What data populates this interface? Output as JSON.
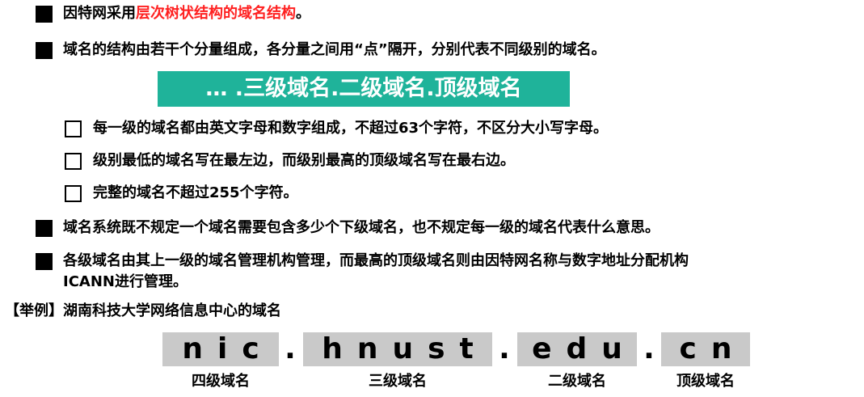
{
  "bullets": [
    {
      "prefix": "因特网采用",
      "highlight": "层次树状结构的域名结构",
      "suffix": "。"
    },
    {
      "text": "域名的结构由若干个分量组成，各分量之间用“点”隔开，分别代表不同级别的域名。"
    }
  ],
  "banner": "… .三级域名.二级域名.顶级域名",
  "sub_items": [
    "每一级的域名都由英文字母和数字组成，不超过63个字符，不区分大小写字母。",
    "级别最低的域名写在最左边，而级别最高的顶级域名写在最右边。",
    "完整的域名不超过255个字符。"
  ],
  "bullets2": [
    "域名系统既不规定一个域名需要包含多少个下级域名，也不规定每一级的域名代表什么意思。",
    "各级域名由其上一级的域名管理机构管理，而最高的顶级域名则由因特网名称与数字地址分配机构",
    "ICANN进行管理。"
  ],
  "example_title": "【举例】湖南科技大学网络信息中心的域名",
  "domain": {
    "segments": [
      "nic",
      "hnust",
      "edu",
      "cn"
    ],
    "separator": ".",
    "labels": [
      "四级域名",
      "三级域名",
      "二级域名",
      "顶级域名"
    ]
  },
  "colors": {
    "highlight": "#ff2020",
    "banner_bg": "#1fb39a",
    "segment_bg": "#c9c9c9"
  }
}
